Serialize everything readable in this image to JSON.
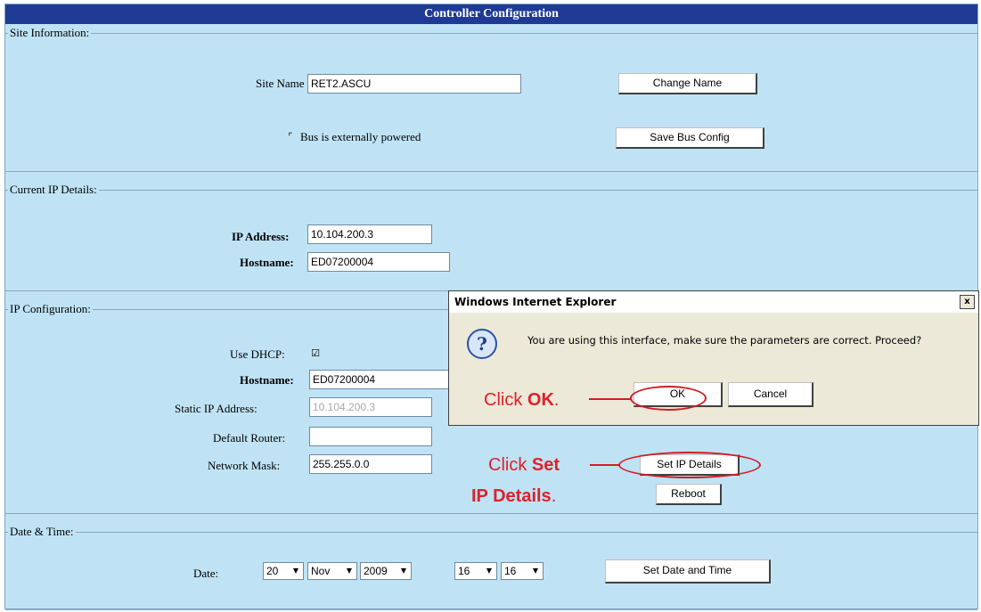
{
  "window": {
    "title": "Controller Configuration"
  },
  "site_info": {
    "legend": "Site Information:",
    "site_name_label": "Site Name",
    "site_name_value": "RET2.ASCU",
    "change_name_button": "Change Name",
    "bus_checkbox_label": "Bus is externally powered",
    "bus_checked": false,
    "save_bus_button": "Save Bus Config"
  },
  "current_ip": {
    "legend": "Current IP Details:",
    "ip_label": "IP Address:",
    "ip_value": "10.104.200.3",
    "hostname_label": "Hostname:",
    "hostname_value": "ED07200004"
  },
  "ip_config": {
    "legend": "IP Configuration:",
    "dhcp_label": "Use DHCP:",
    "dhcp_checked": true,
    "hostname_label": "Hostname:",
    "hostname_value": "ED07200004",
    "static_ip_label": "Static IP Address:",
    "static_ip_value": "10.104.200.3",
    "router_label": "Default Router:",
    "router_value": "",
    "mask_label": "Network Mask:",
    "mask_value": "255.255.0.0",
    "set_ip_button": "Set IP Details",
    "reboot_button": "Reboot"
  },
  "date_time": {
    "legend": "Date & Time:",
    "date_label": "Date:",
    "day": "20",
    "month": "Nov",
    "year": "2009",
    "hour": "16",
    "minute": "16",
    "set_button": "Set Date and Time"
  },
  "dialog": {
    "title": "Windows Internet Explorer",
    "close_glyph": "x",
    "icon_glyph": "?",
    "message": "You are using this interface, make sure the parameters are correct. Proceed?",
    "ok": "OK",
    "cancel": "Cancel"
  },
  "annotations": {
    "click_ok_prefix": "Click ",
    "click_ok_bold": "OK",
    "click_ok_suffix": ".",
    "click_set_prefix": "Click ",
    "click_set_bold1": "Set",
    "click_set_bold2": "IP Details",
    "click_set_suffix": ".",
    "color": "#e0202a"
  },
  "colors": {
    "panel": "#bfe3f5",
    "titlebar": "#1e3a94",
    "dialog": "#ece9d8"
  }
}
